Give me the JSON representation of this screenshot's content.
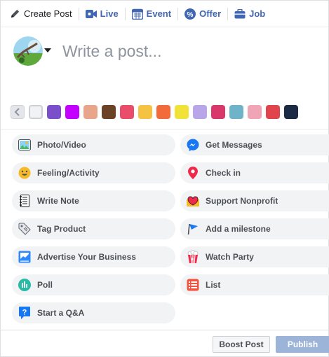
{
  "tabs": [
    {
      "label": "Create Post",
      "icon": "pencil-icon"
    },
    {
      "label": "Live",
      "icon": "video-camera-icon"
    },
    {
      "label": "Event",
      "icon": "calendar-icon"
    },
    {
      "label": "Offer",
      "icon": "percent-tag-icon"
    },
    {
      "label": "Job",
      "icon": "briefcase-icon"
    }
  ],
  "composer": {
    "placeholder": "Write a post...",
    "avatar_icon": "profile-avatar-icon"
  },
  "swatch_colors": [
    "#f0f2f5",
    "#7b4fc9",
    "#c400ff",
    "#e9a58a",
    "#6b4226",
    "#e94d6a",
    "#f5c242",
    "#f36b3b",
    "#f0e236",
    "#b8a6e8",
    "#d9386b",
    "#6fb3c9",
    "#f2a4b7",
    "#e0454d",
    "#1c2a44"
  ],
  "actions": {
    "left": [
      {
        "label": "Photo/Video",
        "icon": "photo-icon"
      },
      {
        "label": "Feeling/Activity",
        "icon": "smiley-icon"
      },
      {
        "label": "Write Note",
        "icon": "notebook-icon"
      },
      {
        "label": "Tag Product",
        "icon": "tag-icon"
      },
      {
        "label": "Advertise Your Business",
        "icon": "advertise-icon"
      },
      {
        "label": "Poll",
        "icon": "poll-icon"
      },
      {
        "label": "Start a Q&A",
        "icon": "question-icon"
      }
    ],
    "right": [
      {
        "label": "Get Messages",
        "icon": "messenger-icon"
      },
      {
        "label": "Check in",
        "icon": "location-pin-icon"
      },
      {
        "label": "Support Nonprofit",
        "icon": "heart-box-icon"
      },
      {
        "label": "Add a milestone",
        "icon": "flag-icon"
      },
      {
        "label": "Watch Party",
        "icon": "popcorn-icon"
      },
      {
        "label": "List",
        "icon": "list-icon"
      }
    ]
  },
  "footer": {
    "boost_label": "Boost Post",
    "publish_label": "Publish"
  },
  "colors": {
    "accent": "#4267b2",
    "publish_disabled": "#9cb4d8",
    "pill_bg": "#f2f3f5"
  }
}
